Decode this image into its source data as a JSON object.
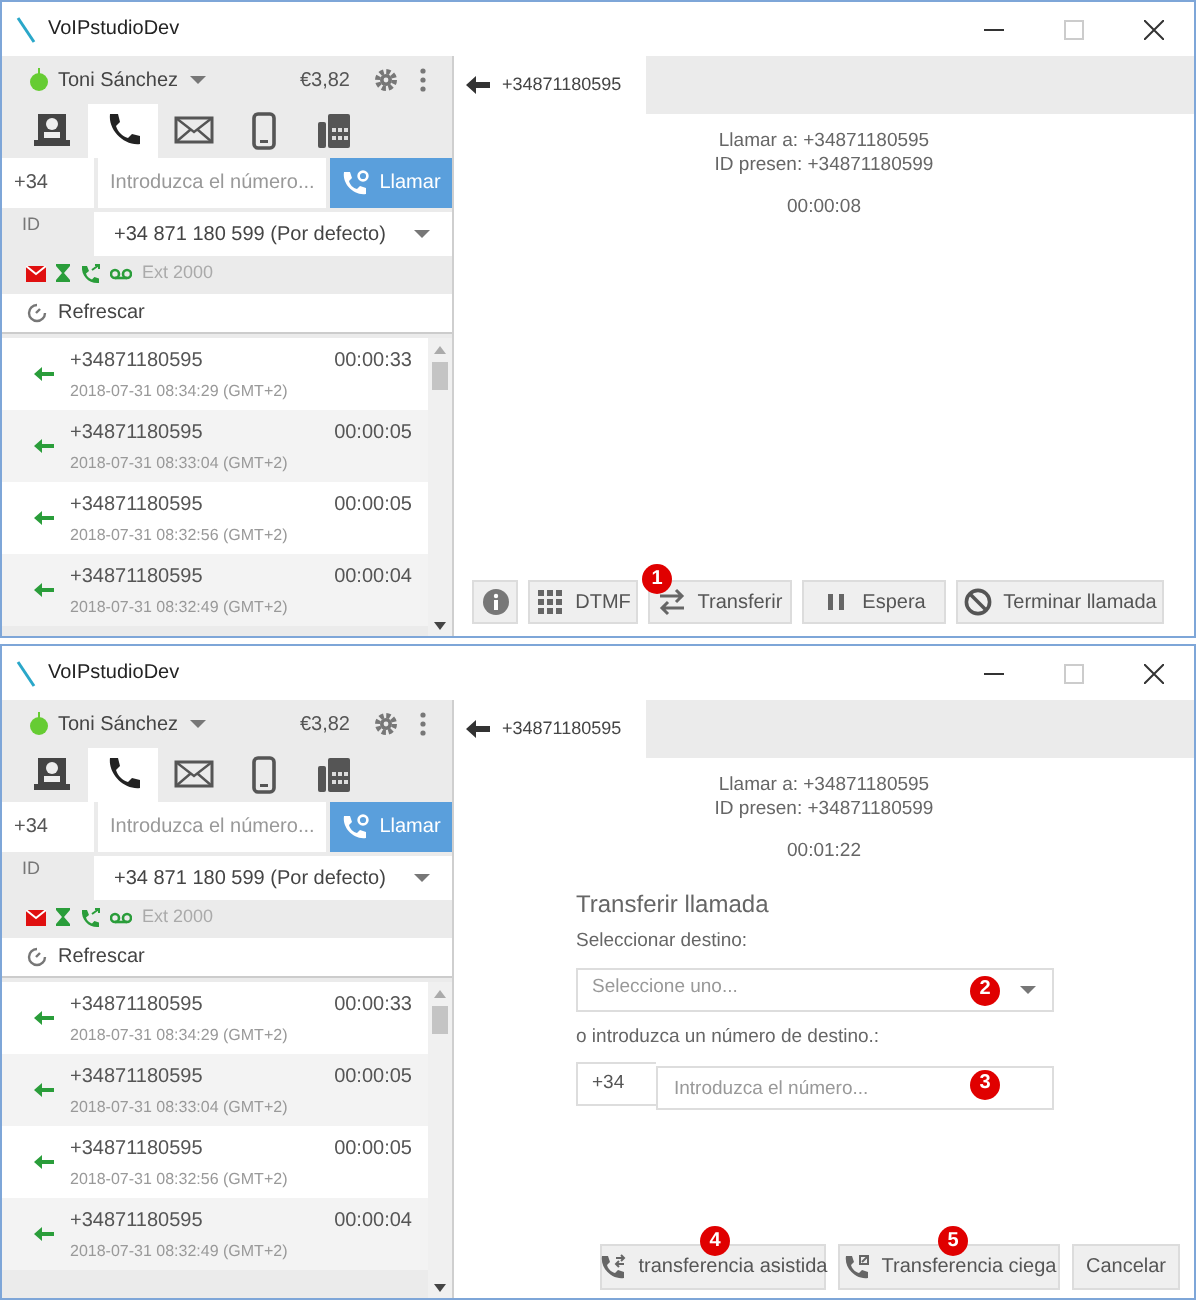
{
  "windows": [
    {
      "title": "VoIPstudioDev",
      "user": {
        "name": "Toni Sánchez"
      },
      "balance": "€3,82",
      "nav_tabs": [
        {
          "kind": "contacts",
          "selected": false
        },
        {
          "kind": "phone",
          "selected": true
        },
        {
          "kind": "mail",
          "selected": false
        },
        {
          "kind": "mobile",
          "selected": false
        },
        {
          "kind": "fax",
          "selected": false
        }
      ],
      "dial": {
        "prefix": "+34",
        "placeholder": "Introduzca el número...",
        "button": "Llamar"
      },
      "caller_id": {
        "label": "ID",
        "value": "+34 871 180 599 (Por defecto)"
      },
      "extension": "Ext 2000",
      "refresh": "Refrescar",
      "calls": [
        {
          "number": "+34871180595",
          "time": "2018-07-31 08:34:29 (GMT+2)",
          "duration": "00:00:33"
        },
        {
          "number": "+34871180595",
          "time": "2018-07-31 08:33:04 (GMT+2)",
          "duration": "00:00:05"
        },
        {
          "number": "+34871180595",
          "time": "2018-07-31 08:32:56 (GMT+2)",
          "duration": "00:00:05"
        },
        {
          "number": "+34871180595",
          "time": "2018-07-31 08:32:49 (GMT+2)",
          "duration": "00:00:04"
        }
      ],
      "call_tab": "+34871180595",
      "call_info": {
        "to": "Llamar a: +34871180595",
        "caller_id": "ID presen: +34871180599",
        "timer": "00:00:08"
      },
      "actions": [
        {
          "kind": "info"
        },
        {
          "kind": "dtmf",
          "label": "DTMF"
        },
        {
          "kind": "transfer",
          "label": "Transferir",
          "callout": "1"
        },
        {
          "kind": "hold",
          "label": "Espera"
        },
        {
          "kind": "hangup",
          "label": "Terminar llamada"
        }
      ]
    },
    {
      "title": "VoIPstudioDev",
      "user": {
        "name": "Toni Sánchez"
      },
      "balance": "€3,82",
      "nav_tabs": [
        {
          "kind": "contacts",
          "selected": false
        },
        {
          "kind": "phone",
          "selected": true
        },
        {
          "kind": "mail",
          "selected": false
        },
        {
          "kind": "mobile",
          "selected": false
        },
        {
          "kind": "fax",
          "selected": false
        }
      ],
      "dial": {
        "prefix": "+34",
        "placeholder": "Introduzca el número...",
        "button": "Llamar"
      },
      "caller_id": {
        "label": "ID",
        "value": "+34 871 180 599 (Por defecto)"
      },
      "extension": "Ext 2000",
      "refresh": "Refrescar",
      "calls": [
        {
          "number": "+34871180595",
          "time": "2018-07-31 08:34:29 (GMT+2)",
          "duration": "00:00:33"
        },
        {
          "number": "+34871180595",
          "time": "2018-07-31 08:33:04 (GMT+2)",
          "duration": "00:00:05"
        },
        {
          "number": "+34871180595",
          "time": "2018-07-31 08:32:56 (GMT+2)",
          "duration": "00:00:05"
        },
        {
          "number": "+34871180595",
          "time": "2018-07-31 08:32:49 (GMT+2)",
          "duration": "00:00:04"
        }
      ],
      "call_tab": "+34871180595",
      "call_info": {
        "to": "Llamar a: +34871180595",
        "caller_id": "ID presen: +34871180599",
        "timer": "00:01:22"
      },
      "transfer": {
        "title": "Transferir llamada",
        "select_label": "Seleccionar destino:",
        "select_placeholder": "Seleccione uno...",
        "select_callout": "2",
        "number_label": "o introduzca un número de destino.:",
        "prefix": "+34",
        "number_placeholder": "Introduzca el número...",
        "number_callout": "3",
        "buttons": [
          {
            "kind": "assisted",
            "label": "transferencia asistida",
            "callout": "4"
          },
          {
            "kind": "blind",
            "label": "Transferencia ciega",
            "callout": "5"
          },
          {
            "kind": "cancel",
            "label": "Cancelar"
          }
        ]
      }
    }
  ]
}
